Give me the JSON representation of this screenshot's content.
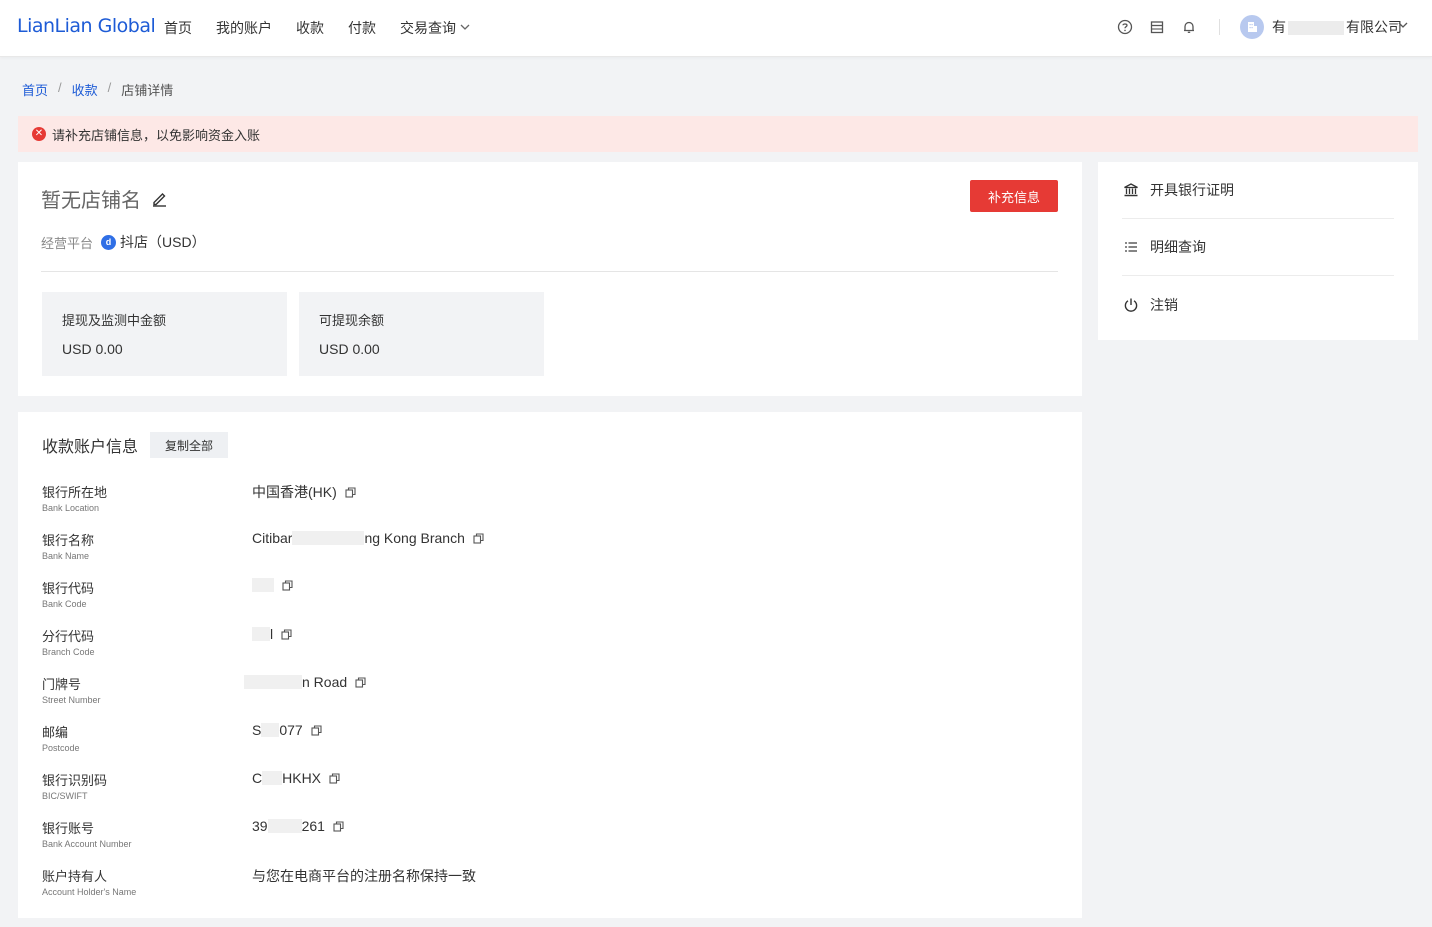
{
  "header": {
    "logo": "LianLian Global",
    "nav": [
      "首页",
      "我的账户",
      "收款",
      "付款",
      "交易查询"
    ],
    "company_prefix": "有",
    "company_suffix": "有限公司"
  },
  "breadcrumb": {
    "home": "首页",
    "receive": "收款",
    "current": "店铺详情"
  },
  "alert": {
    "text": "请补充店铺信息，以免影响资金入账"
  },
  "store": {
    "title": "暂无店铺名",
    "action_label": "补充信息",
    "platform_label": "经营平台",
    "platform_value": "抖店（USD）",
    "stats": [
      {
        "label": "提现及监测中金额",
        "value": "USD 0.00"
      },
      {
        "label": "可提现余额",
        "value": "USD 0.00"
      }
    ]
  },
  "side_menu": [
    {
      "label": "开具银行证明",
      "icon": "bank-icon"
    },
    {
      "label": "明细查询",
      "icon": "list-icon"
    },
    {
      "label": "注销",
      "icon": "power-icon"
    }
  ],
  "account": {
    "title": "收款账户信息",
    "copy_all": "复制全部",
    "rows": [
      {
        "cn": "银行所在地",
        "en": "Bank Location",
        "pre": "中国香港(HK)",
        "post": ""
      },
      {
        "cn": "银行名称",
        "en": "Bank Name",
        "pre": "Citibar",
        "post": "ng Kong Branch"
      },
      {
        "cn": "银行代码",
        "en": "Bank Code",
        "pre": "",
        "post": ""
      },
      {
        "cn": "分行代码",
        "en": "Branch Code",
        "pre": "",
        "post": "l"
      },
      {
        "cn": "门牌号",
        "en": "Street Number",
        "pre": "",
        "post": "n Road"
      },
      {
        "cn": "邮编",
        "en": "Postcode",
        "pre": "S",
        "post": "077"
      },
      {
        "cn": "银行识别码",
        "en": "BIC/SWIFT",
        "pre": "C",
        "post": "HKHX"
      },
      {
        "cn": "银行账号",
        "en": "Bank Account Number",
        "pre": "39",
        "post": "261"
      },
      {
        "cn": "账户持有人",
        "en": "Account Holder's Name",
        "pre": "与您在电商平台的注册名称保持一致",
        "post": ""
      }
    ]
  },
  "colors": {
    "brand": "#1d5bd6",
    "danger": "#e63a35",
    "alert_bg": "#fde8e6"
  }
}
